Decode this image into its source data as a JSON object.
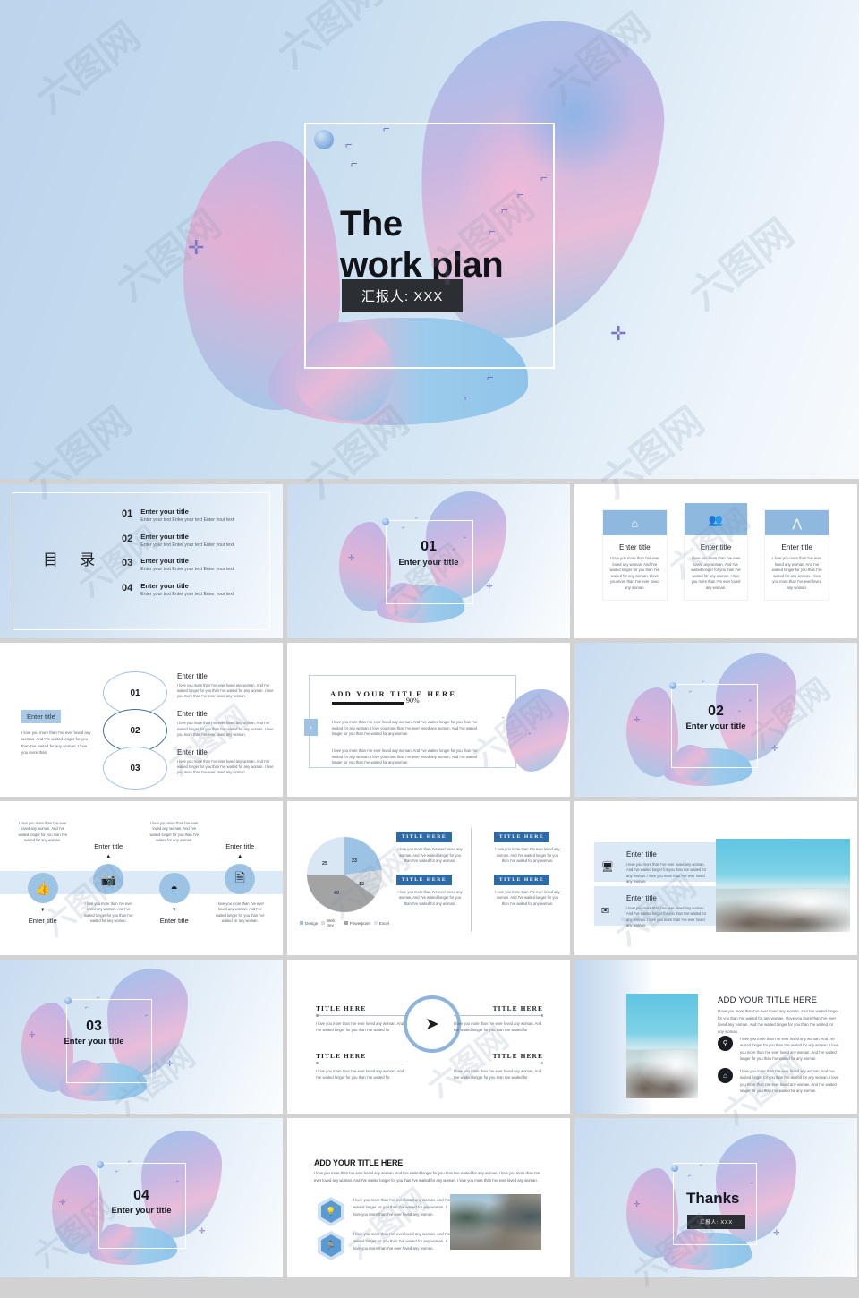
{
  "hero": {
    "title_line1": "The",
    "title_line2": "work plan",
    "presenter_badge": "汇报人: XXX"
  },
  "common": {
    "enter_title": "Enter title",
    "enter_your_title": "Enter your title",
    "title_here": "TITLE HERE",
    "add_your_title_here": "ADD YOUR TITLE HERE",
    "lorem_short": "I love you more than I've ever loved any woman. And I've waited longer for you than I've waited for any woman.",
    "lorem_card": "I love you more than I've ever loved any woman. And I've waited longer for you than I've waited for any woman. I love you more than I've ever loved any woman.",
    "lorem_quad": "I love you more than I've ever loved any woman. And I've waited longer for you than I've waited for",
    "lorem_long": "I love you more than I've ever loved any woman. And I've waited longer for you than I've waited for any woman. I love you more than I've ever loved any woman. And I've waited longer for you than I've waited for any woman. I love you more than I've ever loved any woman.",
    "lorem_med": "I love you more than I've ever loved any woman. And I've waited longer for you than I've waited for any woman. I love you more than I've ever loved any woman. And I've waited longer for you than I've waited for any woman."
  },
  "toc": {
    "heading": "目 录",
    "items": [
      {
        "num": "01",
        "title": "Enter your title",
        "text": "Enter your text Enter your text Enter your text"
      },
      {
        "num": "02",
        "title": "Enter your title",
        "text": "Enter your text Enter your text Enter your text"
      },
      {
        "num": "03",
        "title": "Enter your title",
        "text": "Enter your text Enter your text Enter your text"
      },
      {
        "num": "04",
        "title": "Enter your title",
        "text": "Enter your text Enter your text Enter your text"
      }
    ]
  },
  "dividers": [
    {
      "num": "01",
      "subtitle": "Enter your title"
    },
    {
      "num": "02",
      "subtitle": "Enter your title"
    },
    {
      "num": "03",
      "subtitle": "Enter your title"
    },
    {
      "num": "04",
      "subtitle": "Enter your title"
    }
  ],
  "cards_slide": {
    "cards": [
      {
        "icon": "home-icon",
        "glyph": "⌂",
        "title": "Enter title",
        "text": "I love you more than I've ever loved any woman. And I've waited longer for you than I've waited for any woman. I love you more than I've ever loved any woman."
      },
      {
        "icon": "people-icon",
        "glyph": "👥",
        "title": "Enter title",
        "text": "I love you more than I've ever loved any woman. And I've waited longer for you than I've waited for any woman. I love you more than I've ever loved any woman."
      },
      {
        "icon": "cheers-icon",
        "glyph": "⋀",
        "title": "Enter title",
        "text": "I love you more than I've ever loved any woman. And I've waited longer for you than I've waited for any woman. I love you more than I've ever loved any woman."
      }
    ]
  },
  "circles_slide": {
    "tag": "Enter title",
    "tag_text": "I love you more than I've ever loved any woman. And I've waited longer for you than I've waited for any woman. I love you more than",
    "items": [
      {
        "num": "01",
        "title": "Enter title",
        "text": "I love you more than I've ever loved any woman. And I've waited longer for you than I've waited for any woman. I love you more than I've ever loved any woman."
      },
      {
        "num": "02",
        "title": "Enter title",
        "text": "I love you more than I've ever loved any woman. And I've waited longer for you than I've waited for any woman. I love you more than I've ever loved any woman."
      },
      {
        "num": "03",
        "title": "Enter title",
        "text": "I love you more than I've ever loved any woman. And I've waited longer for you than I've waited for any woman. I love you more than I've ever loved any woman."
      }
    ]
  },
  "progress_slide": {
    "title": "ADD YOUR TITLE HERE",
    "percent": "90%",
    "percent_value": 90,
    "paragraph1": "I love you more than I've ever loved any woman. And I've waited longer for you than I've waited for any woman. I love you more than I've ever loved any woman. And I've waited longer for you than I've waited for any woman.",
    "paragraph2": "I love you more than I've ever loved any woman. And I've waited longer for you than I've waited for any woman. I love you more than I've ever loved any woman. And I've waited longer for you than I've waited for any woman.",
    "arrow": "›"
  },
  "icons_slide": {
    "columns": [
      {
        "icon": "thumbs-up-icon",
        "glyph": "👍",
        "title": "Enter title",
        "text": "I love you more than I've ever loved any woman. And I've waited longer for you than I've waited for any woman.",
        "position": "below"
      },
      {
        "icon": "camera-icon",
        "glyph": "📷",
        "title": "Enter title",
        "text": "I love you more than I've ever loved any woman. And I've waited longer for you than I've waited for any woman.",
        "position": "above"
      },
      {
        "icon": "rss-icon",
        "glyph": "🛜",
        "title": "Enter title",
        "text": "I love you more than I've ever loved any woman. And I've waited longer for you than I've waited for any woman.",
        "position": "below"
      },
      {
        "icon": "document-icon",
        "glyph": "🗒",
        "title": "Enter title",
        "text": "I love you more than I've ever loved any woman. And I've waited longer for you than I've waited for any woman.",
        "position": "above"
      }
    ]
  },
  "chart_data": {
    "type": "pie",
    "title": "",
    "categories": [
      "Design",
      "Web Dev",
      "Powerpoint",
      "Excel"
    ],
    "values": [
      23,
      12,
      40,
      25
    ],
    "colors": [
      "#9cc3e4",
      "#d9dde0",
      "#a3a3a3",
      "#d9e7f5"
    ],
    "legend_position": "bottom",
    "data_labels": true
  },
  "pie_slide": {
    "blocks": [
      {
        "tag": "TITLE HERE",
        "text": "I love you more than I've ever loved any woman. And I've waited longer for you than I've waited for any woman."
      },
      {
        "tag": "TITLE HERE",
        "text": "I love you more than I've ever loved any woman. And I've waited longer for you than I've waited for any woman."
      },
      {
        "tag": "TITLE HERE",
        "text": "I love you more than I've ever loved any woman. And I've waited longer for you than I've waited for any woman."
      },
      {
        "tag": "TITLE HERE",
        "text": "I love you more than I've ever loved any woman. And I've waited longer for you than I've waited for any woman."
      }
    ]
  },
  "media_slide": {
    "rows": [
      {
        "icon": "monitor-icon",
        "glyph": "🖥",
        "title": "Enter title",
        "text": "I love you more than I've ever loved any woman. And I've waited longer for you than I've waited for any woman. I love you more than I've ever loved any woman."
      },
      {
        "icon": "envelope-icon",
        "glyph": "✉",
        "title": "Enter title",
        "text": "I love you more than I've ever loved any woman. And I've waited longer for you than I've waited for any woman. I love you more than I've ever loved any woman."
      }
    ],
    "photo_alt": "ocean-waves-photo"
  },
  "quad_slide": {
    "center_icon": "paper-plane-icon",
    "center_glyph": "➤",
    "cells": [
      {
        "title": "TITLE HERE",
        "text": "I love you more than I've ever loved any woman. And I've waited longer for you than I've waited for"
      },
      {
        "title": "TITLE HERE",
        "text": "I love you more than I've ever loved any woman. And I've waited longer for you than I've waited for"
      },
      {
        "title": "TITLE HERE",
        "text": "I love you more than I've ever loved any woman. And I've waited longer for you than I've waited for"
      },
      {
        "title": "TITLE HERE",
        "text": "I love you more than I've ever loved any woman. And I've waited longer for you than I've waited for"
      }
    ]
  },
  "photo_bullets_slide": {
    "title": "ADD YOUR TITLE HERE",
    "intro": "I love you more than I've ever loved any woman. And I've waited longer for you than I've waited for any woman. I love you more than I've ever loved any woman. And I've waited longer for you than I've waited for any woman.",
    "photo_alt": "ocean-waves-photo",
    "bullets": [
      {
        "icon": "key-icon",
        "glyph": "⚲",
        "text": "I love you more than I've ever loved any woman. And I've waited longer for you than I've waited for any woman. I love you more than I've ever loved any woman. And I've waited longer for you than I've waited for any woman."
      },
      {
        "icon": "home-icon",
        "glyph": "⌂",
        "text": "I love you more than I've ever loved any woman. And I've waited longer for you than I've waited for any woman. I love you more than I've ever loved any woman. And I've waited longer for you than I've waited for any woman."
      }
    ]
  },
  "hex_slide": {
    "title": "ADD YOUR TITLE HERE",
    "intro": "I love you more than I've ever loved any woman. And I've waited longer for you than I've waited for any woman. I love you more than I've ever loved any woman. And I've waited longer for you than I've waited for any woman. I love you more than I've ever loved any woman.",
    "photo_alt": "lake-pier-photo",
    "rows": [
      {
        "icon": "lightbulb-icon",
        "glyph": "💡",
        "text": "I love you more than I've ever loved any woman. And I've waited longer for you than I've waited for any woman. I love you more than I've ever loved any woman."
      },
      {
        "icon": "runner-icon",
        "glyph": "🏃",
        "text": "I love you more than I've ever loved any woman. And I've waited longer for you than I've waited for any woman. I love you more than I've ever loved any woman."
      }
    ]
  },
  "thanks": {
    "title": "Thanks",
    "badge": "汇报人: XXX"
  },
  "watermark": {
    "text": "六图网"
  },
  "palette": {
    "accent_blue": "#8fb8de",
    "deep_blue": "#2f6aa8",
    "band_blue": "#dce9f6",
    "dark": "#2b2e33",
    "pink": "#e8bdd9"
  }
}
